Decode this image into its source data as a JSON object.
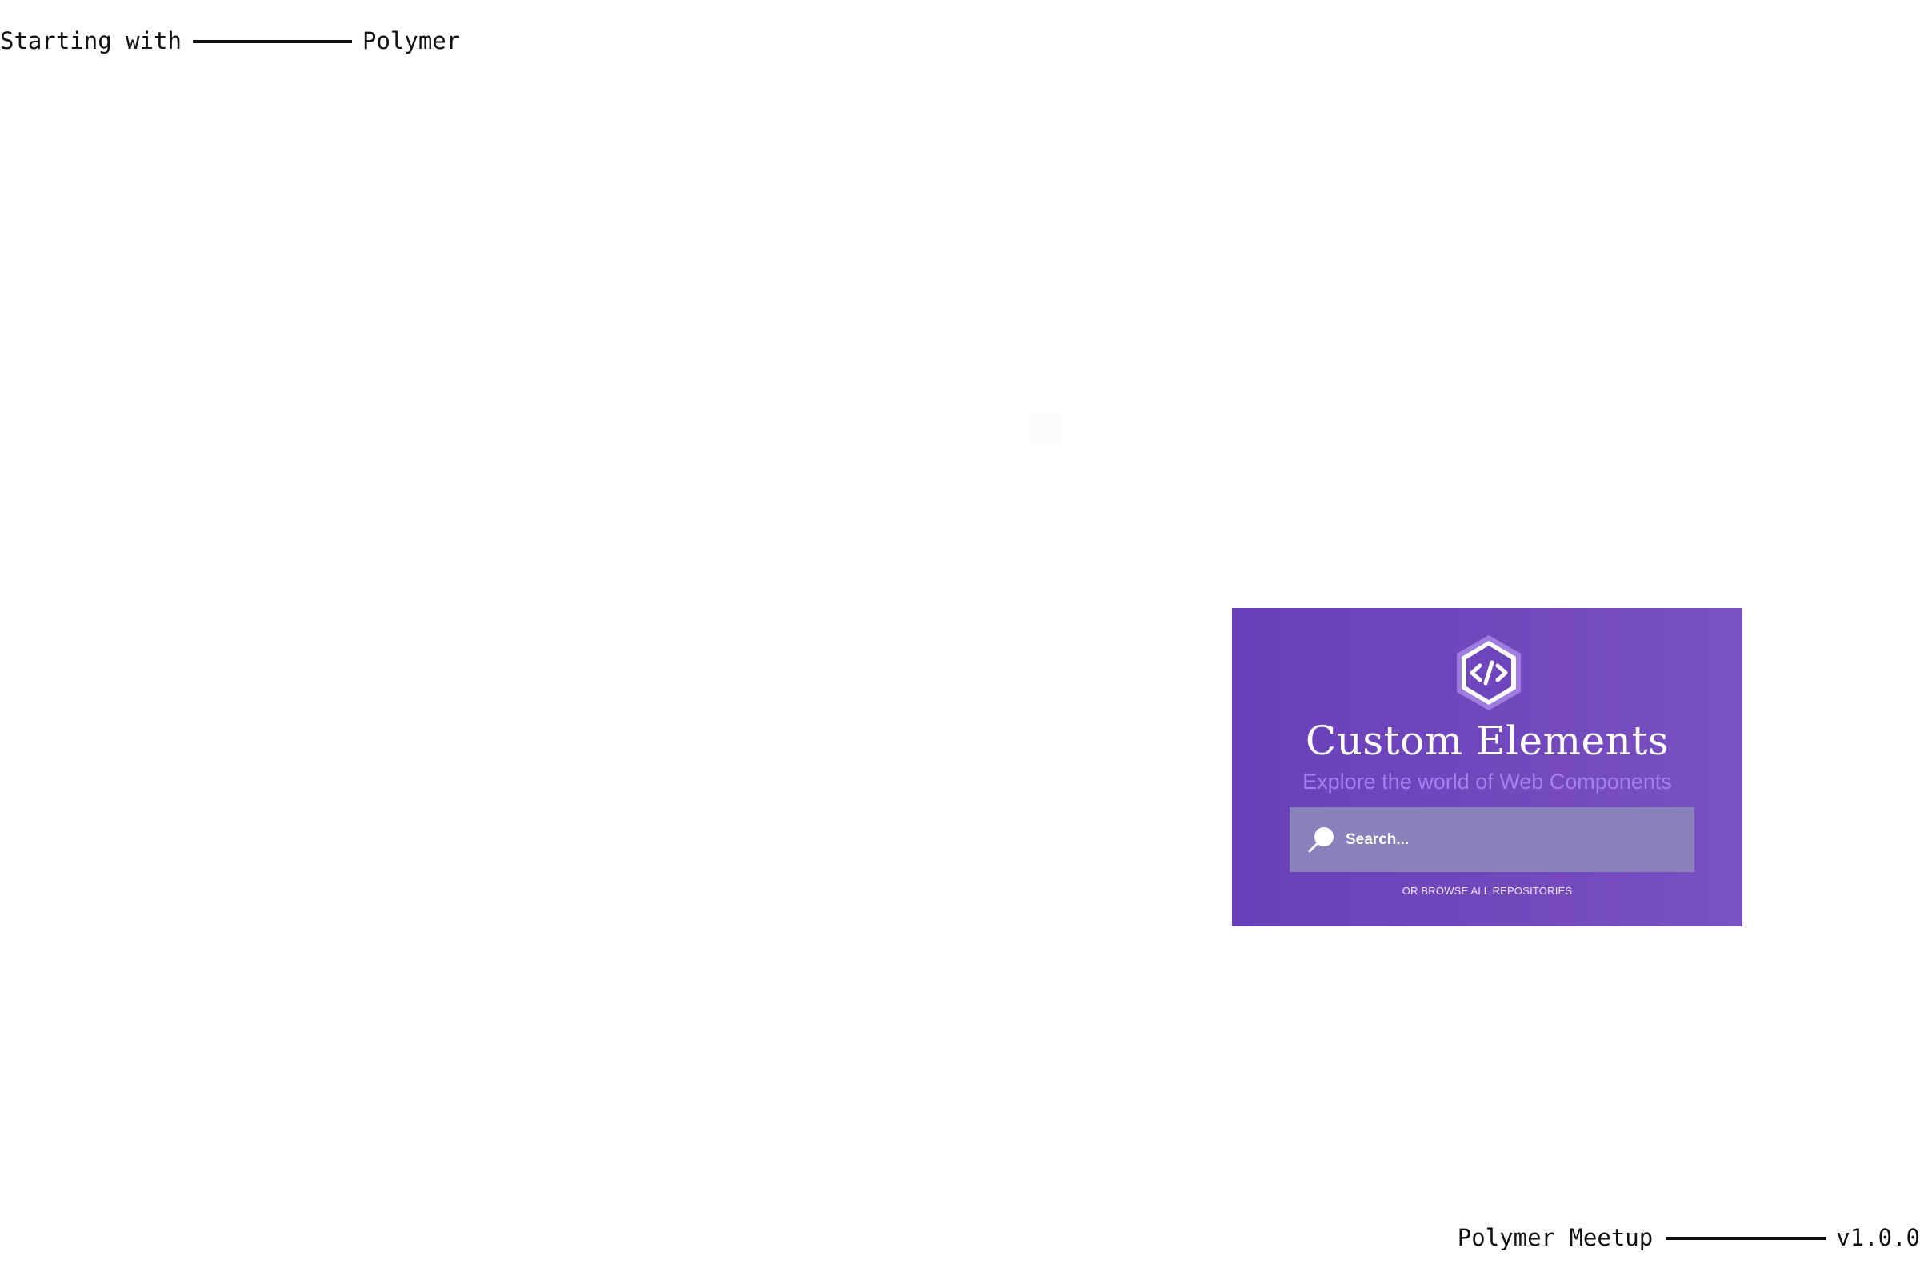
{
  "header": {
    "left_text": "Starting with",
    "right_text": "Polymer"
  },
  "footer": {
    "left_text": "Polymer Meetup",
    "right_text": "v1.0.0"
  },
  "panel": {
    "logo_icon": "code-brackets-hexagon-icon",
    "title": "Custom Elements",
    "subtitle": "Explore the world of Web Components",
    "search": {
      "placeholder": "Search...",
      "icon": "search-icon"
    },
    "browse_link": "OR BROWSE ALL REPOSITORIES",
    "colors": {
      "background_start": "#6a40ba",
      "background_end": "#7a52c3",
      "subtitle": "#a57fee",
      "search_box": "#8881bb"
    }
  }
}
